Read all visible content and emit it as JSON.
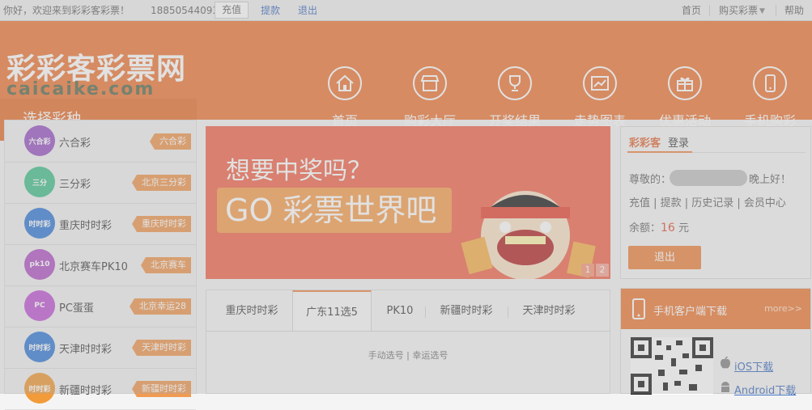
{
  "topbar": {
    "welcome": "你好，欢迎来到彩彩客彩票！",
    "phone": "18850544093",
    "recharge": "充值",
    "withdraw": "提款",
    "logout": "退出",
    "home": "首页",
    "buy": "购买彩票",
    "help": "帮助"
  },
  "header": {
    "logo_cn": "彩彩客彩票网",
    "logo_en": "caicaike.com",
    "select_lottery": "选择彩种",
    "nav": [
      {
        "label": "首页",
        "icon": "home-icon"
      },
      {
        "label": "购彩大厅",
        "icon": "store-icon"
      },
      {
        "label": "开奖结果",
        "icon": "trophy-icon"
      },
      {
        "label": "走势图表",
        "icon": "chart-icon"
      },
      {
        "label": "优惠活动",
        "icon": "gift-icon"
      },
      {
        "label": "手机购彩",
        "icon": "mobile-icon"
      }
    ]
  },
  "sidebar": {
    "items": [
      {
        "name": "六合彩",
        "tag": "六合彩",
        "icon_text": "六合彩",
        "color": "#9b59c7"
      },
      {
        "name": "三分彩",
        "tag": "北京三分彩",
        "icon_text": "三分",
        "color": "#49c28f"
      },
      {
        "name": "重庆时时彩",
        "tag": "重庆时时彩",
        "icon_text": "时时彩",
        "color": "#3a7ed8"
      },
      {
        "name": "北京赛车PK10",
        "tag": "北京赛车",
        "icon_text": "pk10",
        "color": "#b45ac8"
      },
      {
        "name": "PC蛋蛋",
        "tag": "北京幸运28",
        "icon_text": "PC",
        "color": "#c35bd6"
      },
      {
        "name": "天津时时彩",
        "tag": "天津时时彩",
        "icon_text": "时时彩",
        "color": "#3a7ed8"
      },
      {
        "name": "新疆时时彩",
        "tag": "新疆时时彩",
        "icon_text": "时时彩",
        "color": "#f29b3a"
      }
    ]
  },
  "banner": {
    "line1": "想要中奖吗？",
    "line2": "GO 彩票世界吧",
    "dot1": "1",
    "dot2": "2"
  },
  "tabs": {
    "items": [
      "重庆时时彩",
      "广东11选5",
      "PK10",
      "新疆时时彩",
      "天津时时彩"
    ],
    "active_index": 1,
    "pick_links": "手动选号 | 幸运选号"
  },
  "login": {
    "brand": "彩彩客",
    "title": "登录",
    "greet_label": "尊敬的：",
    "greet_tail": "晚上好！",
    "links": "充值 | 提款 | 历史记录 | 会员中心",
    "balance_label": "余额：",
    "balance_value": "16",
    "balance_unit": " 元",
    "logout": "退出"
  },
  "app": {
    "title": "手机客户端下载",
    "more": "more>>",
    "ios": "iOS下载",
    "android": "Android下载"
  },
  "colors": {
    "brand_orange": "#ef7c3d",
    "accent_red": "#e4543a",
    "link_blue": "#3f6fc0"
  }
}
